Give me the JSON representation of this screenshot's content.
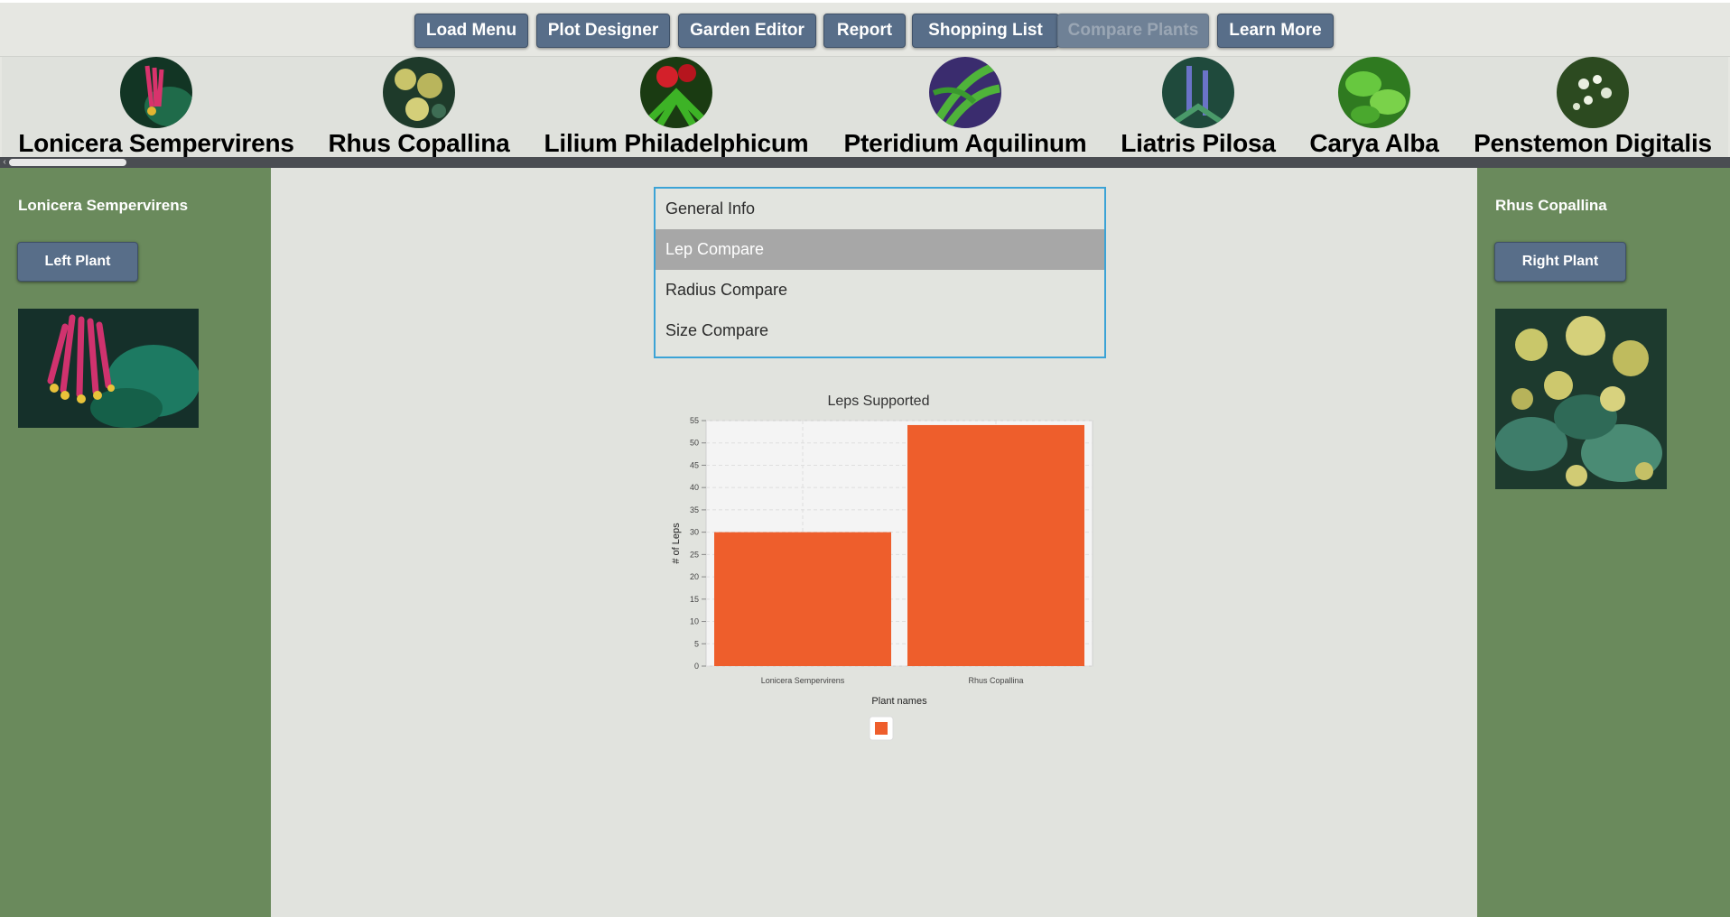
{
  "nav": {
    "buttons": [
      {
        "label": "Load Menu",
        "disabled": false
      },
      {
        "label": "Plot Designer",
        "disabled": false
      },
      {
        "label": "Garden Editor",
        "disabled": false
      },
      {
        "label": "Report",
        "disabled": false
      },
      {
        "label": "Shopping List",
        "disabled": false
      },
      {
        "label": "Compare Plants",
        "disabled": true
      },
      {
        "label": "Learn More",
        "disabled": false
      }
    ]
  },
  "plants": [
    {
      "name": "Lonicera Sempervirens",
      "icon": "plant-photo-icon"
    },
    {
      "name": "Rhus Copallina",
      "icon": "plant-photo-icon"
    },
    {
      "name": "Lilium Philadelphicum",
      "icon": "plant-photo-icon"
    },
    {
      "name": "Pteridium Aquilinum",
      "icon": "plant-photo-icon"
    },
    {
      "name": "Liatris Pilosa",
      "icon": "plant-photo-icon"
    },
    {
      "name": "Carya Alba",
      "icon": "plant-photo-icon"
    },
    {
      "name": "Penstemon Digitalis",
      "icon": "plant-photo-icon"
    }
  ],
  "left_panel": {
    "title": "Lonicera Sempervirens",
    "button": "Left Plant"
  },
  "right_panel": {
    "title": "Rhus Copallina",
    "button": "Right Plant"
  },
  "compare_list": {
    "items": [
      "General Info",
      "Lep Compare",
      "Radius Compare",
      "Size Compare"
    ],
    "selected": "Lep Compare"
  },
  "colors": {
    "panel": "#6a8a5c",
    "button": "#586e89",
    "bar": "#ee5e2c",
    "selection": "#a7a7a7",
    "list_border": "#3ba3d6"
  },
  "chart_data": {
    "type": "bar",
    "title": "Leps Supported",
    "xlabel": "Plant names",
    "ylabel": "# of Leps",
    "categories": [
      "Lonicera Sempervirens",
      "Rhus Copallina"
    ],
    "values": [
      30,
      54
    ],
    "ylim": [
      0,
      55
    ],
    "yticks": [
      0,
      5,
      10,
      15,
      20,
      25,
      30,
      35,
      40,
      45,
      50,
      55
    ],
    "grid": true,
    "legend": "bottom"
  }
}
